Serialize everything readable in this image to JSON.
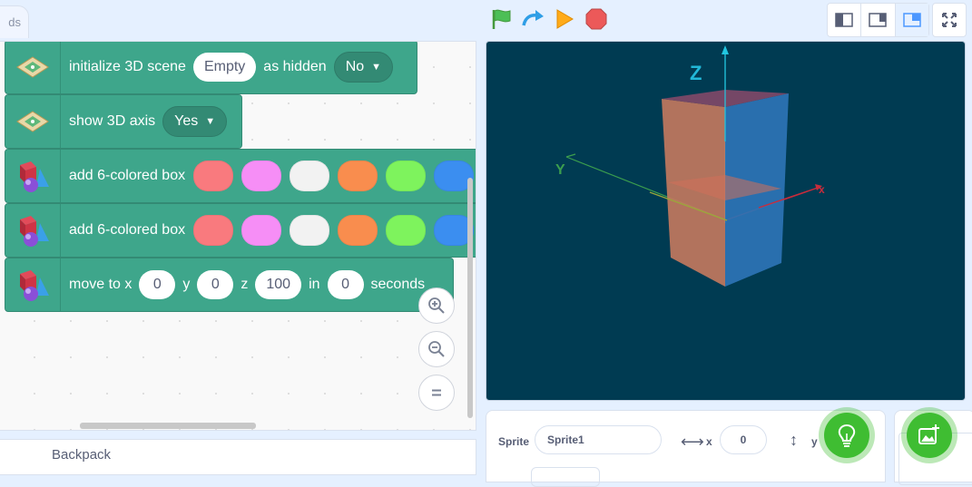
{
  "tab": {
    "label": "ds"
  },
  "blocks": [
    {
      "label": "initialize 3D scene",
      "value": "Empty",
      "label2": "as hidden",
      "dropdown": "No"
    },
    {
      "label": "show 3D axis",
      "dropdown": "Yes"
    },
    {
      "label": "add 6-colored box",
      "colors": [
        "#f97a7e",
        "#f68ef6",
        "#f2f2f2",
        "#f98d4e",
        "#7ef35d",
        "#3b8ef0"
      ]
    },
    {
      "label": "add 6-colored box",
      "colors": [
        "#f97a7e",
        "#f68ef6",
        "#f2f2f2",
        "#f98d4e",
        "#7ef35d",
        "#3b8ef0"
      ]
    },
    {
      "label": "move to x",
      "x": "0",
      "ylabel": "y",
      "y": "0",
      "zlabel": "z",
      "z": "100",
      "inlabel": "in",
      "secs": "0",
      "suffix": "seconds"
    }
  ],
  "backpack": {
    "label": "Backpack"
  },
  "stage": {
    "axis_z": "Z",
    "axis_y": "Y",
    "axis_x": "x"
  },
  "sprite": {
    "label": "Sprite",
    "name": "Sprite1",
    "x_label": "x",
    "x": "0",
    "y_label": "y"
  },
  "colors": {
    "block": "#3ea68b",
    "stage_bg": "#003b52",
    "fab": "#3fbd32"
  }
}
